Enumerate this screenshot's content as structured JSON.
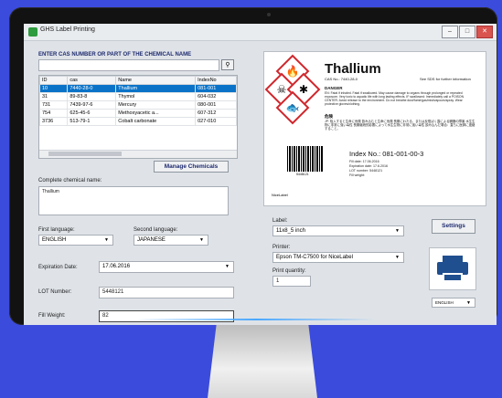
{
  "window": {
    "title": "GHS Label Printing",
    "minimize": "–",
    "maximize": "□",
    "close": "✕"
  },
  "search": {
    "header": "ENTER CAS NUMBER OR PART OF THE CHEMICAL NAME",
    "value": "",
    "button_icon": "search-icon"
  },
  "table": {
    "columns": [
      "ID",
      "cas",
      "Name",
      "IndexNo"
    ],
    "rows": [
      [
        "10",
        "7440-28-0",
        "Thallium",
        "081-001"
      ],
      [
        "31",
        "89-83-8",
        "Thymol",
        "604-032"
      ],
      [
        "731",
        "7439-97-6",
        "Mercury",
        "080-001"
      ],
      [
        "754",
        "625-45-6",
        "Methoxyacetic a...",
        "607-312"
      ],
      [
        "3736",
        "513-79-1",
        "Cobalt carbonate",
        "027-010"
      ]
    ]
  },
  "manage_button": "Manage Chemicals",
  "complete_name": {
    "label": "Complete chemical name:",
    "value": "Thallium"
  },
  "language": {
    "first_label": "First language:",
    "first_value": "ENGLISH",
    "second_label": "Second language:",
    "second_value": "JAPANESE"
  },
  "expiration": {
    "label": "Expiration Date:",
    "value": "17.06.2016"
  },
  "lot": {
    "label": "LOT Number:",
    "value": "5448121"
  },
  "fill": {
    "label": "Fill Weight:",
    "value": "82"
  },
  "label_preview": {
    "name": "Thallium",
    "cas": "CAS No.: 7440-28-0",
    "sds": "See SDS for further information",
    "signal": "DANGER",
    "hazard_text": "EN: Fatal if inhaled. Fatal if swallowed. May cause damage to organs through prolonged or repeated exposure. Very toxic to aquatic life with long lasting effects. IF swallowed: Immediately call a POISON CENTER. Avoid release to the environment. Do not breathe dust/fume/gas/mist/vapours/spray. Wear protective gloves/clothing.",
    "jp_label": "危険",
    "jp_text": "JP: 吸入すると生命に危険 飲み込むと生命に危険 長期にわたる、または反復ばく露による臓器の障害 水生生物に非常に強い毒性 長期継続的影響によって水生生物に非常に強い毒性 飲み込んだ場合：直ちに医師に連絡すること。",
    "barcode_number": "5448121",
    "footer": "NiceLabel",
    "index_no": "Index No.:  081-001-00-3",
    "fill_date": "Fill date:        17.06.2016",
    "expiration": "Expiration date:  17.6.2016",
    "lot_number": "LOT number:       5448121",
    "fill_weight": "Fill weight:"
  },
  "label_select": {
    "label": "Label:",
    "value": "11x8_5 inch"
  },
  "printer_select": {
    "label": "Printer:",
    "value": "Epson TM-C7500 for NiceLabel"
  },
  "print_quantity": {
    "label": "Print quantity:",
    "value": "1"
  },
  "settings_button": "Settings",
  "ui_language": "ENGLISH"
}
